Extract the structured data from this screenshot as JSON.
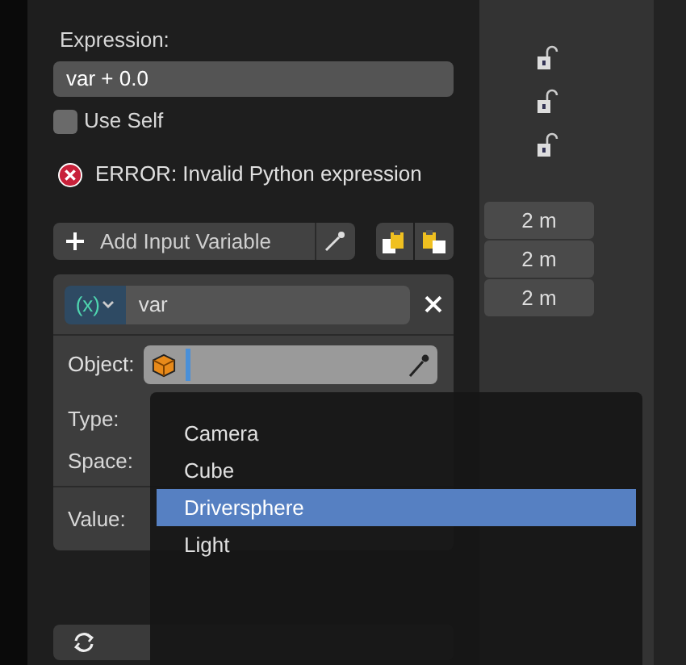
{
  "expression": {
    "label": "Expression:",
    "value": "var + 0.0"
  },
  "use_self": {
    "label": "Use Self",
    "checked": false
  },
  "error": {
    "text": "ERROR: Invalid Python expression"
  },
  "add_variable": {
    "label": "Add Input Variable"
  },
  "variable": {
    "type_symbol": "(x)",
    "name": "var"
  },
  "object_label": "Object:",
  "type_label": "Type:",
  "space_label": "Space:",
  "value_label": "Value:",
  "background_values": [
    "2 m",
    "2 m",
    "2 m"
  ],
  "menu": {
    "items": [
      {
        "label": "Camera",
        "selected": false
      },
      {
        "label": "Cube",
        "selected": false
      },
      {
        "label": "Driversphere",
        "selected": true
      },
      {
        "label": "Light",
        "selected": false
      }
    ]
  }
}
